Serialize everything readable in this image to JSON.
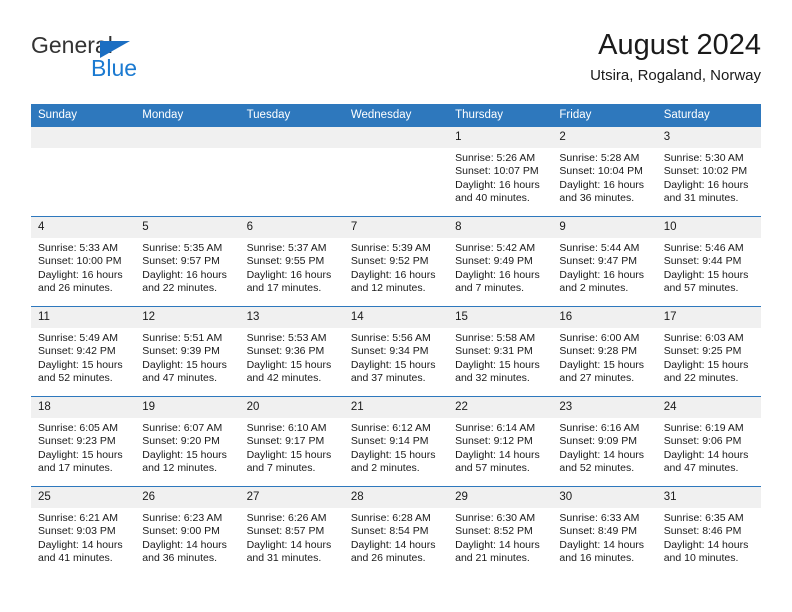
{
  "brand": {
    "word_one": "General",
    "word_two": "Blue",
    "triangle_icon": "triangle-icon",
    "accent_color": "#1b7ad1"
  },
  "header": {
    "title": "August 2024",
    "subtitle": "Utsira, Rogaland, Norway"
  },
  "calendar": {
    "header_bg": "#2e78bd",
    "daynum_bg": "#f0f0f0",
    "weekday_headers": [
      "Sunday",
      "Monday",
      "Tuesday",
      "Wednesday",
      "Thursday",
      "Friday",
      "Saturday"
    ],
    "weeks": [
      [
        {
          "date": ""
        },
        {
          "date": ""
        },
        {
          "date": ""
        },
        {
          "date": ""
        },
        {
          "date": "1",
          "sunrise": "Sunrise: 5:26 AM",
          "sunset": "Sunset: 10:07 PM",
          "daylight_1": "Daylight: 16 hours",
          "daylight_2": "and 40 minutes."
        },
        {
          "date": "2",
          "sunrise": "Sunrise: 5:28 AM",
          "sunset": "Sunset: 10:04 PM",
          "daylight_1": "Daylight: 16 hours",
          "daylight_2": "and 36 minutes."
        },
        {
          "date": "3",
          "sunrise": "Sunrise: 5:30 AM",
          "sunset": "Sunset: 10:02 PM",
          "daylight_1": "Daylight: 16 hours",
          "daylight_2": "and 31 minutes."
        }
      ],
      [
        {
          "date": "4",
          "sunrise": "Sunrise: 5:33 AM",
          "sunset": "Sunset: 10:00 PM",
          "daylight_1": "Daylight: 16 hours",
          "daylight_2": "and 26 minutes."
        },
        {
          "date": "5",
          "sunrise": "Sunrise: 5:35 AM",
          "sunset": "Sunset: 9:57 PM",
          "daylight_1": "Daylight: 16 hours",
          "daylight_2": "and 22 minutes."
        },
        {
          "date": "6",
          "sunrise": "Sunrise: 5:37 AM",
          "sunset": "Sunset: 9:55 PM",
          "daylight_1": "Daylight: 16 hours",
          "daylight_2": "and 17 minutes."
        },
        {
          "date": "7",
          "sunrise": "Sunrise: 5:39 AM",
          "sunset": "Sunset: 9:52 PM",
          "daylight_1": "Daylight: 16 hours",
          "daylight_2": "and 12 minutes."
        },
        {
          "date": "8",
          "sunrise": "Sunrise: 5:42 AM",
          "sunset": "Sunset: 9:49 PM",
          "daylight_1": "Daylight: 16 hours",
          "daylight_2": "and 7 minutes."
        },
        {
          "date": "9",
          "sunrise": "Sunrise: 5:44 AM",
          "sunset": "Sunset: 9:47 PM",
          "daylight_1": "Daylight: 16 hours",
          "daylight_2": "and 2 minutes."
        },
        {
          "date": "10",
          "sunrise": "Sunrise: 5:46 AM",
          "sunset": "Sunset: 9:44 PM",
          "daylight_1": "Daylight: 15 hours",
          "daylight_2": "and 57 minutes."
        }
      ],
      [
        {
          "date": "11",
          "sunrise": "Sunrise: 5:49 AM",
          "sunset": "Sunset: 9:42 PM",
          "daylight_1": "Daylight: 15 hours",
          "daylight_2": "and 52 minutes."
        },
        {
          "date": "12",
          "sunrise": "Sunrise: 5:51 AM",
          "sunset": "Sunset: 9:39 PM",
          "daylight_1": "Daylight: 15 hours",
          "daylight_2": "and 47 minutes."
        },
        {
          "date": "13",
          "sunrise": "Sunrise: 5:53 AM",
          "sunset": "Sunset: 9:36 PM",
          "daylight_1": "Daylight: 15 hours",
          "daylight_2": "and 42 minutes."
        },
        {
          "date": "14",
          "sunrise": "Sunrise: 5:56 AM",
          "sunset": "Sunset: 9:34 PM",
          "daylight_1": "Daylight: 15 hours",
          "daylight_2": "and 37 minutes."
        },
        {
          "date": "15",
          "sunrise": "Sunrise: 5:58 AM",
          "sunset": "Sunset: 9:31 PM",
          "daylight_1": "Daylight: 15 hours",
          "daylight_2": "and 32 minutes."
        },
        {
          "date": "16",
          "sunrise": "Sunrise: 6:00 AM",
          "sunset": "Sunset: 9:28 PM",
          "daylight_1": "Daylight: 15 hours",
          "daylight_2": "and 27 minutes."
        },
        {
          "date": "17",
          "sunrise": "Sunrise: 6:03 AM",
          "sunset": "Sunset: 9:25 PM",
          "daylight_1": "Daylight: 15 hours",
          "daylight_2": "and 22 minutes."
        }
      ],
      [
        {
          "date": "18",
          "sunrise": "Sunrise: 6:05 AM",
          "sunset": "Sunset: 9:23 PM",
          "daylight_1": "Daylight: 15 hours",
          "daylight_2": "and 17 minutes."
        },
        {
          "date": "19",
          "sunrise": "Sunrise: 6:07 AM",
          "sunset": "Sunset: 9:20 PM",
          "daylight_1": "Daylight: 15 hours",
          "daylight_2": "and 12 minutes."
        },
        {
          "date": "20",
          "sunrise": "Sunrise: 6:10 AM",
          "sunset": "Sunset: 9:17 PM",
          "daylight_1": "Daylight: 15 hours",
          "daylight_2": "and 7 minutes."
        },
        {
          "date": "21",
          "sunrise": "Sunrise: 6:12 AM",
          "sunset": "Sunset: 9:14 PM",
          "daylight_1": "Daylight: 15 hours",
          "daylight_2": "and 2 minutes."
        },
        {
          "date": "22",
          "sunrise": "Sunrise: 6:14 AM",
          "sunset": "Sunset: 9:12 PM",
          "daylight_1": "Daylight: 14 hours",
          "daylight_2": "and 57 minutes."
        },
        {
          "date": "23",
          "sunrise": "Sunrise: 6:16 AM",
          "sunset": "Sunset: 9:09 PM",
          "daylight_1": "Daylight: 14 hours",
          "daylight_2": "and 52 minutes."
        },
        {
          "date": "24",
          "sunrise": "Sunrise: 6:19 AM",
          "sunset": "Sunset: 9:06 PM",
          "daylight_1": "Daylight: 14 hours",
          "daylight_2": "and 47 minutes."
        }
      ],
      [
        {
          "date": "25",
          "sunrise": "Sunrise: 6:21 AM",
          "sunset": "Sunset: 9:03 PM",
          "daylight_1": "Daylight: 14 hours",
          "daylight_2": "and 41 minutes."
        },
        {
          "date": "26",
          "sunrise": "Sunrise: 6:23 AM",
          "sunset": "Sunset: 9:00 PM",
          "daylight_1": "Daylight: 14 hours",
          "daylight_2": "and 36 minutes."
        },
        {
          "date": "27",
          "sunrise": "Sunrise: 6:26 AM",
          "sunset": "Sunset: 8:57 PM",
          "daylight_1": "Daylight: 14 hours",
          "daylight_2": "and 31 minutes."
        },
        {
          "date": "28",
          "sunrise": "Sunrise: 6:28 AM",
          "sunset": "Sunset: 8:54 PM",
          "daylight_1": "Daylight: 14 hours",
          "daylight_2": "and 26 minutes."
        },
        {
          "date": "29",
          "sunrise": "Sunrise: 6:30 AM",
          "sunset": "Sunset: 8:52 PM",
          "daylight_1": "Daylight: 14 hours",
          "daylight_2": "and 21 minutes."
        },
        {
          "date": "30",
          "sunrise": "Sunrise: 6:33 AM",
          "sunset": "Sunset: 8:49 PM",
          "daylight_1": "Daylight: 14 hours",
          "daylight_2": "and 16 minutes."
        },
        {
          "date": "31",
          "sunrise": "Sunrise: 6:35 AM",
          "sunset": "Sunset: 8:46 PM",
          "daylight_1": "Daylight: 14 hours",
          "daylight_2": "and 10 minutes."
        }
      ]
    ]
  }
}
